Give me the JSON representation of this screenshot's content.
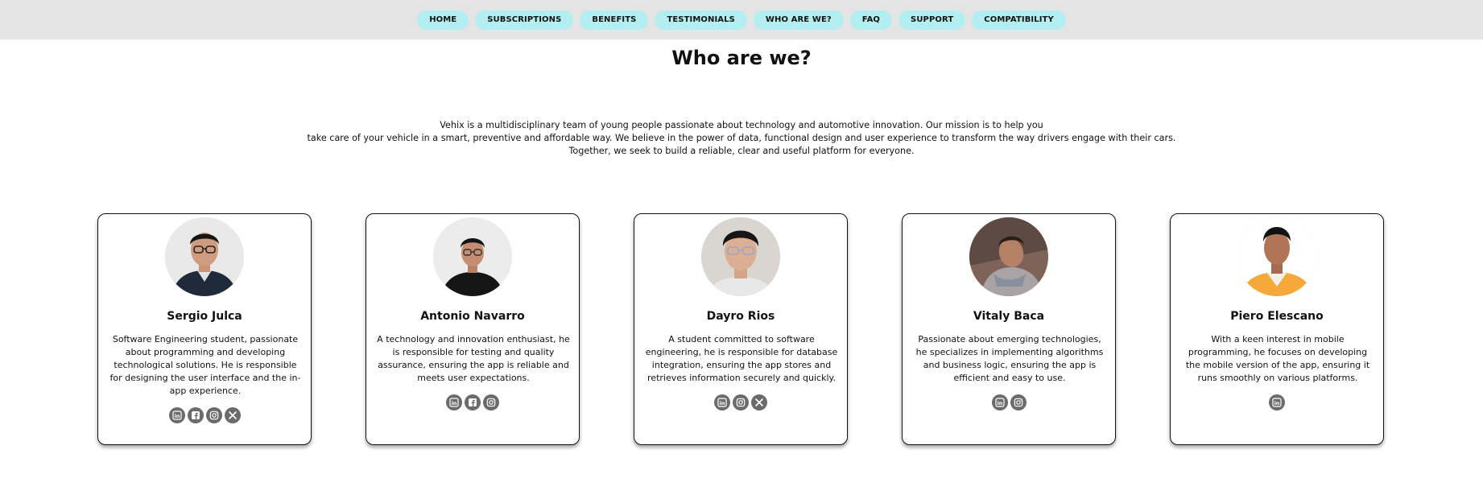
{
  "nav": {
    "items": [
      "HOME",
      "SUBSCRIPTIONS",
      "BENEFITS",
      "TESTIMONIALS",
      "WHO ARE WE?",
      "FAQ",
      "SUPPORT",
      "COMPATIBILITY"
    ]
  },
  "section": {
    "title": "Who are we?",
    "intro_lines": [
      "Vehix is a multidisciplinary team of young people passionate about technology and automotive innovation. Our mission is to help you",
      "take care of your vehicle in a smart, preventive and affordable way. We believe in the power of data, functional design and user experience to transform the way drivers engage with their cars.",
      "Together, we seek to build a reliable, clear and useful platform for everyone."
    ]
  },
  "members": [
    {
      "name": "Sergio Julca",
      "bio": "Software Engineering student, passionate about programming and developing technological solutions. He is responsible for designing the user interface and the in-app experience.",
      "socials": [
        "linkedin-icon",
        "facebook-icon",
        "instagram-icon",
        "x-icon"
      ]
    },
    {
      "name": "Antonio Navarro",
      "bio": "A technology and innovation enthusiast, he is responsible for testing and quality assurance, ensuring the app is reliable and meets user expectations.",
      "socials": [
        "linkedin-icon",
        "facebook-icon",
        "instagram-icon"
      ]
    },
    {
      "name": "Dayro Rios",
      "bio": "A student committed to software engineering, he is responsible for database integration, ensuring the app stores and retrieves information securely and quickly.",
      "socials": [
        "linkedin-icon",
        "instagram-icon",
        "x-icon"
      ]
    },
    {
      "name": "Vitaly Baca",
      "bio": "Passionate about emerging technologies, he specializes in implementing algorithms and business logic, ensuring the app is efficient and easy to use.",
      "socials": [
        "linkedin-icon",
        "instagram-icon"
      ]
    },
    {
      "name": "Piero Elescano",
      "bio": "With a keen interest in mobile programming, he focuses on developing the mobile version of the app, ensuring it runs smoothly on various platforms.",
      "socials": [
        "linkedin-icon"
      ]
    }
  ],
  "colors": {
    "nav_background": "#e4e4e4",
    "nav_pill": "#b3eef2",
    "social_icon_bg": "#6b6b6b"
  }
}
